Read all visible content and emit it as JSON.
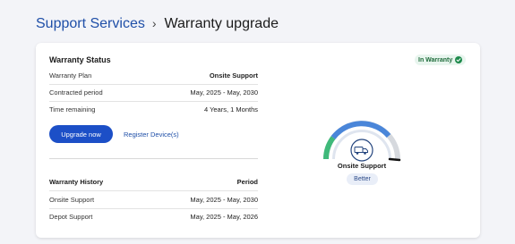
{
  "breadcrumb": {
    "parent": "Support Services",
    "separator": "›",
    "current": "Warranty upgrade"
  },
  "status": {
    "title": "Warranty Status",
    "badge": "In Warranty",
    "rows": [
      {
        "label": "Warranty Plan",
        "value": "Onsite Support"
      },
      {
        "label": "Contracted period",
        "value": "May, 2025 - May, 2030"
      },
      {
        "label": "Time remaining",
        "value": "4 Years, 1 Months"
      }
    ],
    "upgrade_label": "Upgrade now",
    "register_label": "Register Device(s)"
  },
  "history": {
    "title": "Warranty History",
    "column": "Period",
    "rows": [
      {
        "label": "Onsite Support",
        "value": "May, 2025 - May, 2030"
      },
      {
        "label": "Depot Support",
        "value": "May, 2025 - May, 2026"
      }
    ]
  },
  "gauge": {
    "label": "Onsite Support",
    "rating": "Better",
    "icon": "truck-icon"
  },
  "colors": {
    "accent": "#1c4fc7",
    "link": "#1f4fa8",
    "badge_bg": "#e8f5ee",
    "badge_text": "#1e6b3a",
    "gauge_green": "#3fb97a",
    "gauge_blue": "#4a86d9",
    "gauge_grey": "#d6d9de"
  }
}
